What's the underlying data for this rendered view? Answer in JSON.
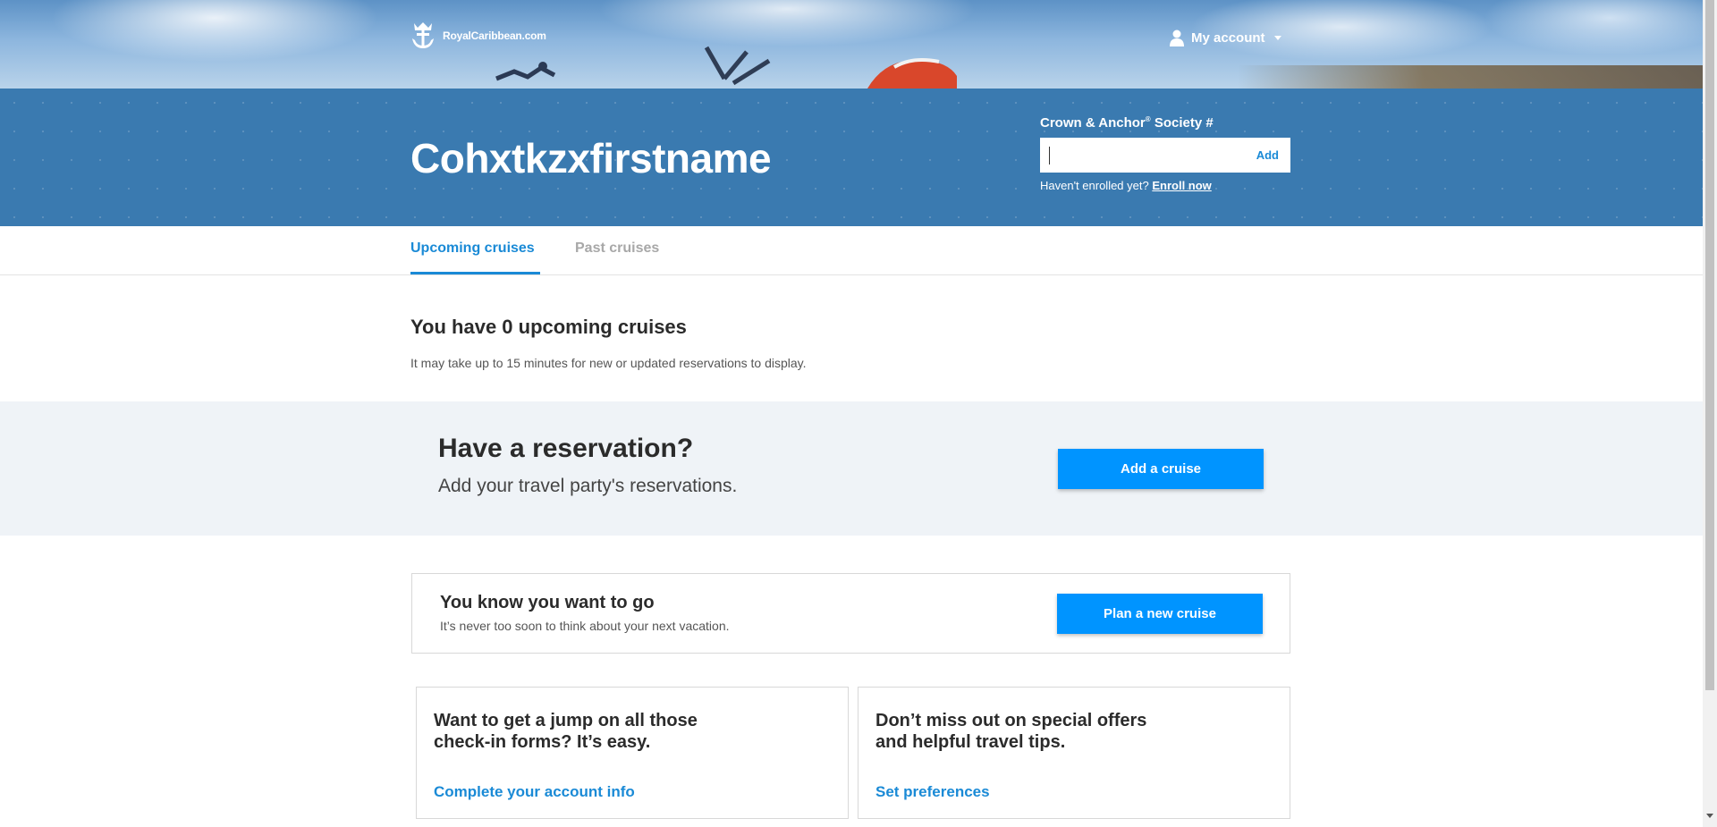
{
  "header": {
    "logo_text": "RoyalCaribbean.com",
    "logo_icon": "anchor-crown-icon",
    "account_label": "My account",
    "account_icon": "user-icon"
  },
  "banner": {
    "user_name": "Cohxtkzxfirstname",
    "cas_label": "Crown & Anchor",
    "cas_label_sup": "®",
    "cas_label_suffix": " Society #",
    "cas_input_value": "",
    "cas_add_label": "Add",
    "enroll_prompt": "Haven't enrolled yet? ",
    "enroll_link": "Enroll now"
  },
  "tabs": [
    {
      "label": "Upcoming cruises",
      "active": true
    },
    {
      "label": "Past cruises",
      "active": false
    }
  ],
  "upcoming": {
    "title": "You have 0 upcoming cruises",
    "note": "It may take up to 15 minutes for new or updated reservations to display."
  },
  "reservation": {
    "title": "Have a reservation?",
    "subtitle": "Add your travel party's reservations.",
    "button": "Add a cruise"
  },
  "plan": {
    "title": "You know you want to go",
    "subtitle": "It’s never too soon to think about your next vacation.",
    "button": "Plan a new cruise"
  },
  "cards": [
    {
      "title": "Want to get a jump on all those check-in forms? It’s easy.",
      "link": "Complete your account info"
    },
    {
      "title": "Don’t miss out on special offers and helpful travel tips.",
      "link": "Set preferences"
    }
  ],
  "colors": {
    "banner_blue": "#3a7ab0",
    "accent_blue": "#0094ff",
    "link_blue": "#1a8ad6"
  }
}
